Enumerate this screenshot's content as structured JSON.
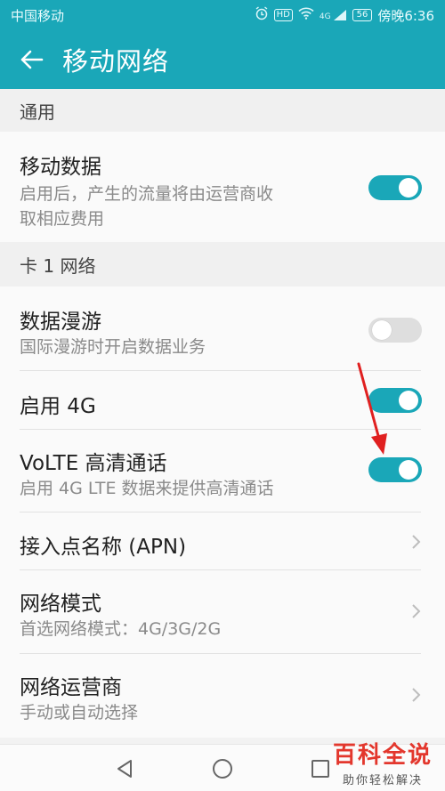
{
  "status_bar": {
    "carrier": "中国移动",
    "hd_label": "HD",
    "signal_label": "4G",
    "battery": "56",
    "time": "傍晚6:36"
  },
  "app_bar": {
    "title": "移动网络"
  },
  "sections": {
    "general": "通用",
    "sim1": "卡 1 网络"
  },
  "rows": {
    "mobile_data": {
      "label": "移动数据",
      "desc_line1": "启用后，产生的流量将由运营商收",
      "desc_line2": "取相应费用",
      "state": "on"
    },
    "roaming": {
      "label": "数据漫游",
      "desc": "国际漫游时开启数据业务",
      "state": "off"
    },
    "enable_4g": {
      "label": "启用 4G",
      "state": "on"
    },
    "volte": {
      "label": "VoLTE 高清通话",
      "desc": "启用 4G LTE 数据来提供高清通话",
      "state": "on"
    },
    "apn": {
      "label": "接入点名称 (APN)"
    },
    "network_mode": {
      "label": "网络模式",
      "desc": "首选网络模式：4G/3G/2G"
    },
    "operator": {
      "label": "网络运营商",
      "desc": "手动或自动选择"
    }
  },
  "watermark": {
    "title": "百科全说",
    "subtitle": "助你轻松解决"
  },
  "colors": {
    "accent": "#1aa7b8",
    "toggle_off": "#dedede",
    "arrow": "#e02020"
  },
  "icons": {
    "back": "arrow-left-icon",
    "chevron": "chevron-right-icon",
    "nav_back": "triangle-back-icon",
    "nav_home": "circle-home-icon",
    "nav_recent": "square-recent-icon"
  }
}
